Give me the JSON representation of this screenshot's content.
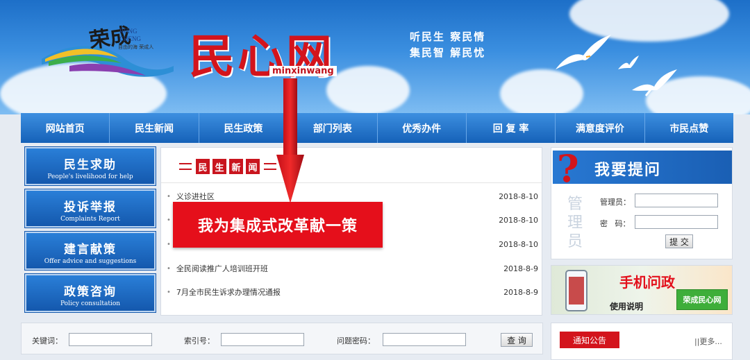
{
  "banner": {
    "logo_chars": "荣成",
    "logo_sub1": "RONG",
    "logo_sub2": "CHENG",
    "logo_slogan": "自由的海 荣成人",
    "site_title": "民心网",
    "site_subtitle": "minxinwang",
    "slogan_line1": "听民生  察民情",
    "slogan_line2": "集民智  解民忧"
  },
  "nav": {
    "items": [
      "网站首页",
      "民生新闻",
      "民生政策",
      "部门列表",
      "优秀办件",
      "回 复 率",
      "满意度评价",
      "市民点赞"
    ]
  },
  "sidebar": {
    "items": [
      {
        "zh": "民生求助",
        "en": "People's livelihood for help"
      },
      {
        "zh": "投诉举报",
        "en": "Complaints Report"
      },
      {
        "zh": "建言献策",
        "en": "Offer advice and suggestions"
      },
      {
        "zh": "政策咨询",
        "en": "Policy consultation"
      }
    ]
  },
  "news": {
    "header_chars": [
      "民",
      "生",
      "新",
      "闻"
    ],
    "rows": [
      {
        "title": "义诊进社区",
        "date": "2018-8-10"
      },
      {
        "title": "",
        "date": "2018-8-10"
      },
      {
        "title": "",
        "date": "2018-8-10"
      },
      {
        "title": "全民阅读推广人培训班开班",
        "date": "2018-8-9"
      },
      {
        "title": "7月全市民生诉求办理情况通报",
        "date": "2018-8-9"
      }
    ]
  },
  "overlay": {
    "text": "我为集成式改革献一策"
  },
  "ask": {
    "title": "我要提问",
    "admin_vertical": [
      "管",
      "理",
      "员"
    ],
    "username_label": "管理员：",
    "password_label": "密   码：",
    "submit_label": "提 交"
  },
  "mobile": {
    "title": "手机问政",
    "usage": "使用说明",
    "app_name": "荣成民心网"
  },
  "search": {
    "keyword_label": "关键词：",
    "index_label": "索引号：",
    "code_label": "问题密码：",
    "button_label": "查 询"
  },
  "notice": {
    "tab_label": "通知公告",
    "more_label": "||更多..."
  },
  "colors": {
    "brand_red": "#d3141c",
    "nav_blue": "#1561b8",
    "sky_blue": "#3b8fe0"
  }
}
